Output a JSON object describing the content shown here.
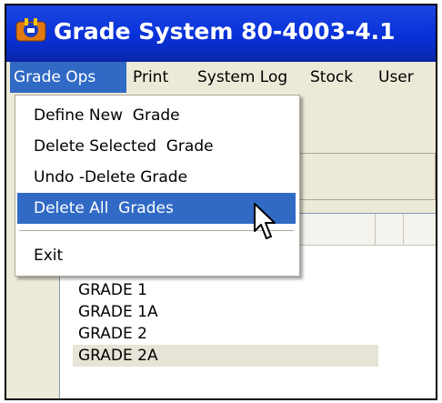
{
  "window": {
    "title": "Grade System 80-4003-4.1"
  },
  "menubar": {
    "items": [
      {
        "label": "Grade Ops",
        "active": true
      },
      {
        "label": "Print"
      },
      {
        "label": "System Log"
      },
      {
        "label": "Stock"
      },
      {
        "label": "User"
      }
    ]
  },
  "dropdown": {
    "items": [
      {
        "label": "Define New  Grade"
      },
      {
        "label": "Delete Selected  Grade"
      },
      {
        "label": "Undo -Delete Grade"
      },
      {
        "label": "Delete All  Grades",
        "highlighted": true
      },
      {
        "label": "Exit"
      }
    ]
  },
  "grade_list": {
    "rows": [
      {
        "label": "GRADE 1"
      },
      {
        "label": "GRADE 1A"
      },
      {
        "label": "GRADE 2"
      },
      {
        "label": "GRADE 2A",
        "selected": true
      }
    ]
  },
  "colors": {
    "titlebar": "#0831d9",
    "menu_highlight": "#316ac5",
    "window_bg": "#ece9d8"
  },
  "icons": {
    "app": "app-icon",
    "cursor": "mouse-pointer-icon"
  }
}
